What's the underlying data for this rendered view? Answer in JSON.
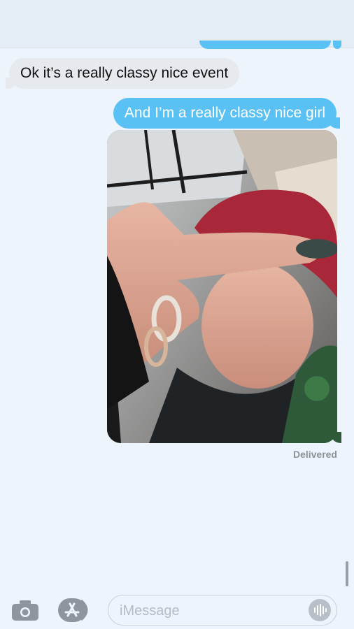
{
  "messages": [
    {
      "direction": "incoming",
      "text": "Ok it’s a really classy nice event"
    },
    {
      "direction": "outgoing",
      "text": "And I’m a really classy nice girl"
    },
    {
      "direction": "outgoing",
      "type": "photo"
    }
  ],
  "status": {
    "delivered": "Delivered"
  },
  "composer": {
    "placeholder": "iMessage"
  },
  "icons": {
    "camera": "camera-icon",
    "apps": "app-store-icon",
    "audio": "waveform-icon"
  },
  "colors": {
    "outgoing_bubble": "#5ac1f4",
    "incoming_bubble": "#e6e9ee",
    "background": "#eef4fb"
  }
}
